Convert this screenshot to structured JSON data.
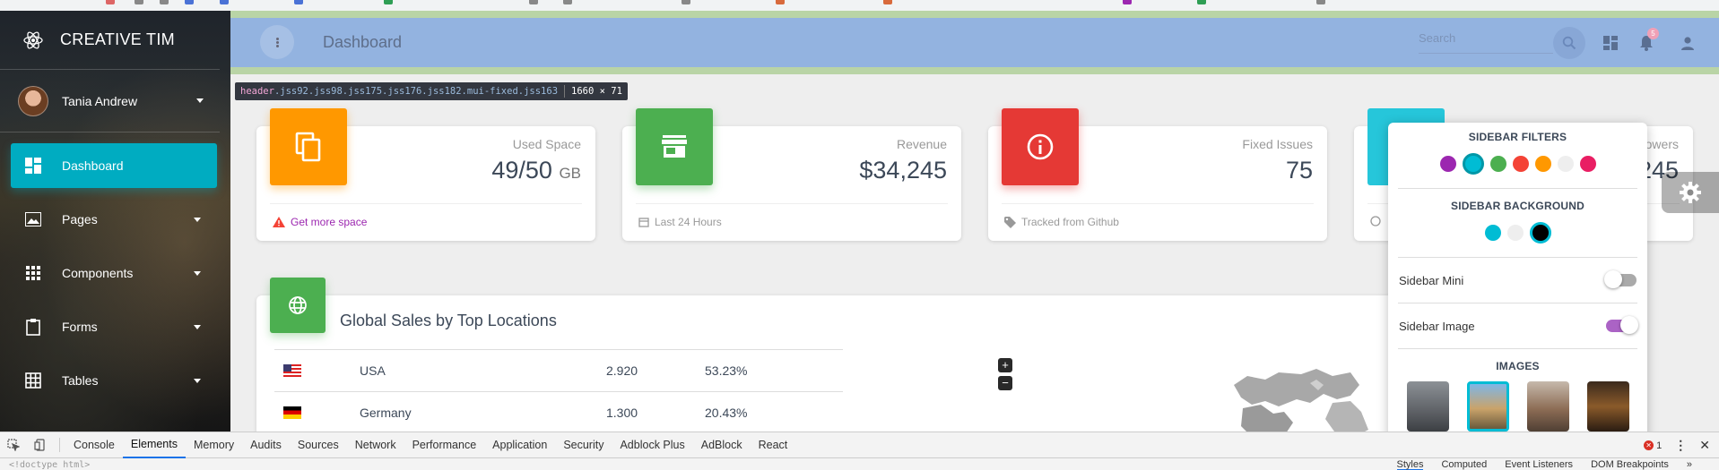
{
  "sidebar": {
    "brand": "CREATIVE TIM",
    "user_name": "Tania Andrew",
    "items": [
      {
        "label": "Dashboard",
        "icon": "dashboard-icon"
      },
      {
        "label": "Pages",
        "icon": "image-icon"
      },
      {
        "label": "Components",
        "icon": "apps-icon"
      },
      {
        "label": "Forms",
        "icon": "clipboard-icon"
      },
      {
        "label": "Tables",
        "icon": "grid-on-icon"
      }
    ]
  },
  "header": {
    "title": "Dashboard",
    "search_placeholder": "Search",
    "notification_count": "5"
  },
  "inspect_tooltip": {
    "tag": "header",
    "classes": ".jss92.jss98.jss175.jss176.jss182.mui-fixed.jss163",
    "size": "1660 × 71"
  },
  "cards": [
    {
      "category": "Used Space",
      "value": "49/50",
      "unit": "GB",
      "footer": "Get more space",
      "color": "#ff9800",
      "icon": "content-copy-icon"
    },
    {
      "category": "Revenue",
      "value": "$34,245",
      "footer": "Last 24 Hours",
      "color": "#4caf50",
      "icon": "store-icon"
    },
    {
      "category": "Fixed Issues",
      "value": "75",
      "footer": "Tracked from Github",
      "color": "#e53935",
      "icon": "info-outline-icon"
    },
    {
      "category": "owers",
      "value": "245",
      "color": "#26c6da"
    }
  ],
  "sales": {
    "title": "Global Sales by Top Locations",
    "rows": [
      {
        "country": "USA",
        "amount": "2.920",
        "percent": "53.23%"
      },
      {
        "country": "Germany",
        "amount": "1.300",
        "percent": "20.43%"
      }
    ]
  },
  "plugin": {
    "filters_title": "SIDEBAR FILTERS",
    "filter_colors": [
      "#9c27b0",
      "#00bcd4",
      "#4caf50",
      "#f44336",
      "#ff9800",
      "#eeeeee",
      "#e91e63"
    ],
    "background_title": "SIDEBAR BACKGROUND",
    "background_colors": [
      "#00bcd4",
      "#eeeeee",
      "#000000"
    ],
    "sidebar_mini_label": "Sidebar Mini",
    "sidebar_mini_on": false,
    "sidebar_image_label": "Sidebar Image",
    "sidebar_image_on": true,
    "images_title": "IMAGES"
  },
  "devtools": {
    "tabs": [
      "Console",
      "Elements",
      "Memory",
      "Audits",
      "Sources",
      "Network",
      "Performance",
      "Application",
      "Security",
      "Adblock Plus",
      "AdBlock",
      "React"
    ],
    "active_tab": "Elements",
    "error_count": "1",
    "doctype_line": "<!doctype html>",
    "sub_tabs": [
      "Styles",
      "Computed",
      "Event Listeners",
      "DOM Breakpoints"
    ]
  }
}
